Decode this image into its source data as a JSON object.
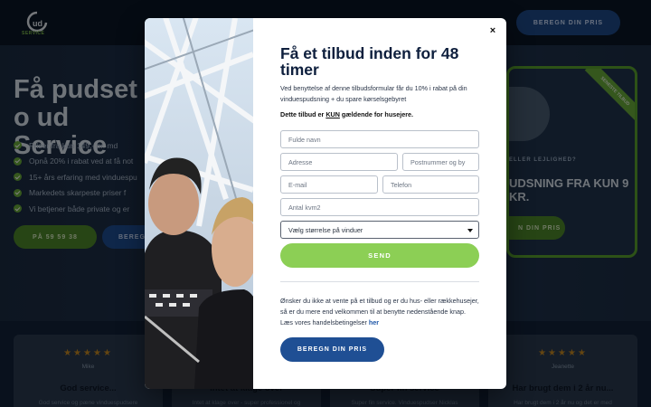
{
  "background": {
    "logo_text": "SERVICE",
    "header_cta": "BEREGN DIN PRIS",
    "hero_title": "Få pudset o ud Service",
    "bullets": [
      "Priser fra kun 149,- pr. md",
      "Opnå 20% i rabat ved at få not",
      "15+ års erfaring med vinduespu",
      "Markedets skarpeste priser f",
      "Vi betjener både private og er"
    ],
    "btn_green": "PÅ 59 59 38",
    "btn_blue": "BEREG",
    "card": {
      "ribbon": "SENESTE TILBUD",
      "line1": "ELLER LEJLIGHED?",
      "line2": "UDSNING FRA KUN 9 KR.",
      "button": "N DIN PRIS"
    },
    "reviews": [
      {
        "stars": "★★★★★",
        "name": "Mike",
        "title": "God service...",
        "text": "God service og pæne vinduespudsere"
      },
      {
        "stars": "★★★★★",
        "name": "",
        "title": "Intet at klage over",
        "text": "Intet at klage over - super professionel og"
      },
      {
        "stars": "★★★★★",
        "name": "",
        "title": "Super fin service",
        "text": "Super fin service. Vinduespudser Nicklas"
      },
      {
        "stars": "★★★★★",
        "name": "Jeanette",
        "title": "Har brugt dem i 2 år nu...",
        "text": "Har brugt dem i 2 år nu og det er med"
      }
    ]
  },
  "modal": {
    "title": "Få et tilbud inden for 48 timer",
    "description": "Ved benyttelse af denne tilbudsformular får du 10% i rabat på din vinduespudsning + du spare kørselsgebyret",
    "note_pre": "Dette tilbud er ",
    "note_emph": "KUN",
    "note_post": " gældende for husejere.",
    "close_label": "×",
    "fields": {
      "full_name": "Fulde navn",
      "address": "Adresse",
      "postal": "Postnummer og by",
      "email": "E-mail",
      "phone": "Telefon",
      "area": "Antal kvm2"
    },
    "select_value": "Vælg størrelse på vinduer",
    "send_label": "SEND",
    "bottom_text": "Ønsker du ikke at vente på et tilbud og er du hus- eller rækkehusejer, så er du mere end velkommen til at benytte nedenstående knap. Læs vores handelsbetingelser ",
    "bottom_link": "her",
    "calc_label": "BEREGN DIN PRIS"
  },
  "colors": {
    "send_green": "#8ccf55",
    "calc_blue": "#1f4f94",
    "title_navy": "#0e1f3d",
    "link_blue": "#1f58a8"
  }
}
